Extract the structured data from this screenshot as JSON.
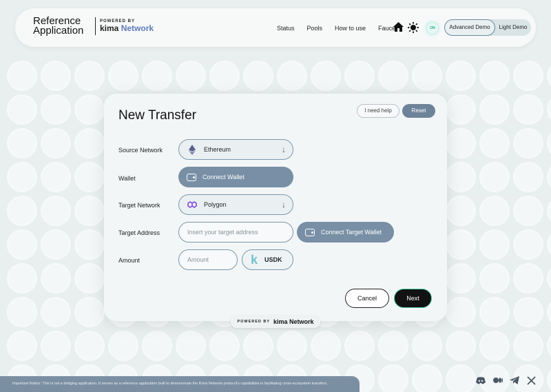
{
  "header": {
    "brand_title": "Reference Application",
    "powered_by": "POWERED BY",
    "kima": "kima",
    "network": "Network",
    "nav": [
      "Status",
      "Pools",
      "How to use",
      "Faucet"
    ],
    "toggle_badge": "ON",
    "demo_advanced": "Advanced Demo",
    "demo_light": "Light Demo"
  },
  "card": {
    "title": "New Transfer",
    "help": "I need help",
    "reset": "Reset",
    "labels": {
      "source_network": "Source Network",
      "wallet": "Wallet",
      "target_network": "Target Network",
      "target_address": "Target Address",
      "amount": "Amount"
    },
    "source_network_value": "Ethereum",
    "connect_wallet": "Connect Wallet",
    "target_network_value": "Polygon",
    "target_address_placeholder": "Insert your target address",
    "connect_target_wallet": "Connect Target Wallet",
    "amount_placeholder": "Amount",
    "token": "USDK",
    "cancel": "Cancel",
    "next": "Next"
  },
  "footer": {
    "powered_by": "POWERED BY",
    "kima_network": "kima Network",
    "notice": "Important Notice: This is not a bridging application. It serves as a reference application built to demonstrate the Kima Network protocol's capabilities in facilitating cross-ecosystem transfers."
  },
  "icons": {
    "source_network": "ethereum-icon",
    "target_network": "polygon-icon",
    "social": [
      "discord-icon",
      "medium-icon",
      "telegram-icon",
      "x-icon"
    ]
  },
  "colors": {
    "accent": "#788fa5",
    "next_border": "#4bd0a4",
    "brand_network": "#5f7ab8"
  }
}
